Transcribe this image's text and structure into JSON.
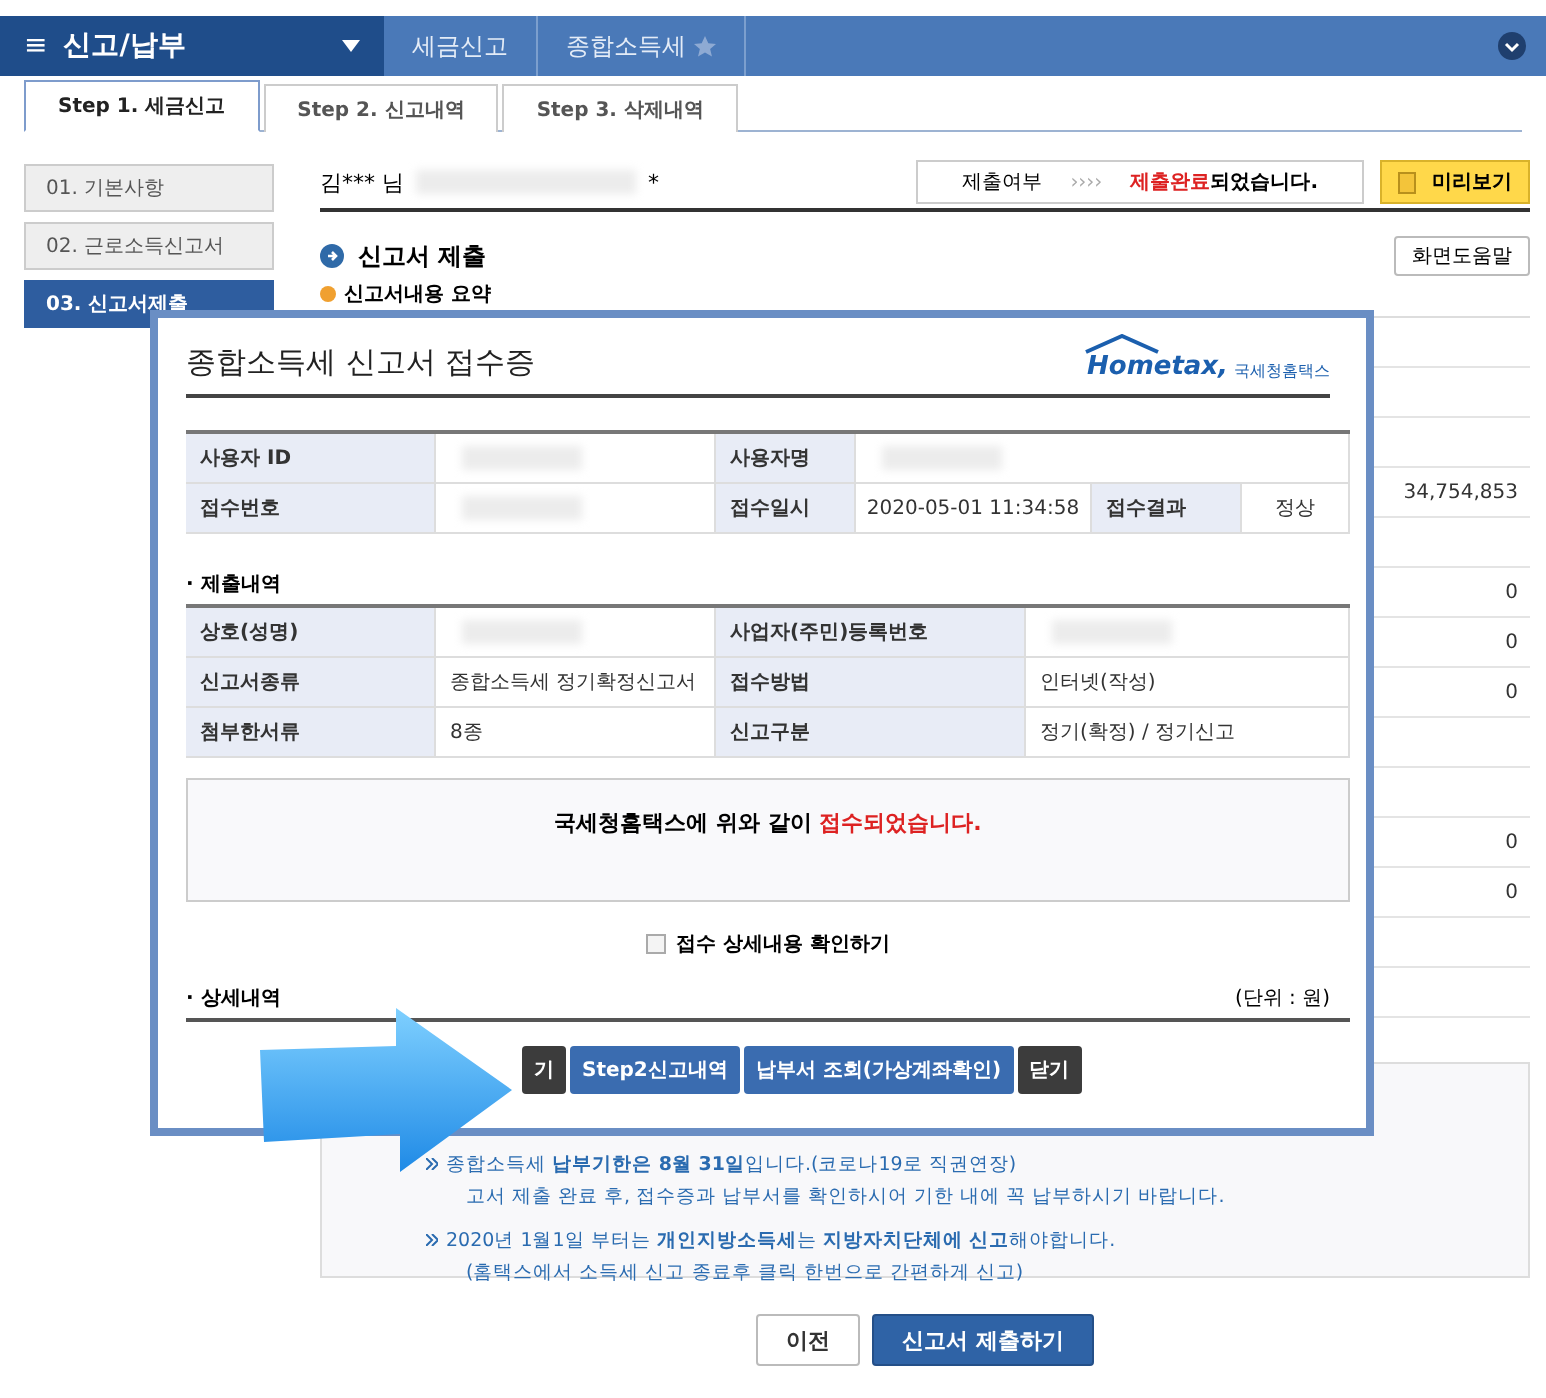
{
  "nav": {
    "menu_icon": "≡",
    "title": "신고/납부",
    "breadcrumbs": [
      {
        "label": "세금신고",
        "star": false
      },
      {
        "label": "종합소득세",
        "star": true
      }
    ]
  },
  "steps": [
    {
      "label": "Step 1. 세금신고",
      "selected": true
    },
    {
      "label": "Step 2. 신고내역",
      "selected": false
    },
    {
      "label": "Step 3. 삭제내역",
      "selected": false
    }
  ],
  "sidebar": [
    {
      "label": "01. 기본사항",
      "selected": false
    },
    {
      "label": "02. 근로소득신고서",
      "selected": false
    },
    {
      "label": "03. 신고서제출",
      "selected": true
    }
  ],
  "user_line": {
    "name": "김*** 님",
    "tail": "*"
  },
  "status": {
    "label": "제출여부",
    "arrows": "››››",
    "highlight": "제출완료",
    "rest": "되었습니다."
  },
  "preview_button": "미리보기",
  "section_title": "신고서 제출",
  "help_button": "화면도움말",
  "subsection": "신고서내용 요약",
  "summary_rows": [
    {
      "kind": "blank"
    },
    {
      "kind": "blank"
    },
    {
      "kind": "blank"
    },
    {
      "kind": "amount",
      "value": "34,754,853"
    },
    {
      "kind": "blank"
    },
    {
      "kind": "amount",
      "value": "0"
    },
    {
      "kind": "amount",
      "value": "0"
    },
    {
      "kind": "amount",
      "value": "0"
    },
    {
      "kind": "blank"
    },
    {
      "kind": "blank"
    },
    {
      "kind": "amount",
      "value": "0"
    },
    {
      "kind": "amount",
      "value": "0"
    },
    {
      "kind": "blank"
    },
    {
      "kind": "blank"
    }
  ],
  "notes": [
    {
      "kind": "bullet",
      "text": "종합소득세 **납부기한은 8월 31일**입니다.(코로나19로 직권연장)"
    },
    {
      "kind": "continuation",
      "text": "고서 제출 완료 후, 접수증과 납부서를 확인하시어 기한 내에 꼭 납부하시기 바랍니다."
    },
    {
      "kind": "bullet",
      "text": "2020년 1월1일 부터는 **개인지방소득세**는 **지방자치단체에 신고**해야합니다."
    },
    {
      "kind": "continuation",
      "text": "(홈택스에서 소득세 신고 종료후 클릭 한번으로 간편하게 신고)"
    }
  ],
  "bottom_buttons": [
    {
      "label": "이전",
      "kind": "secondary"
    },
    {
      "label": "신고서 제출하기",
      "kind": "primary"
    }
  ],
  "dialog": {
    "title": "종합소득세 신고서 접수증",
    "logo": {
      "main": "Hometax,",
      "sub": "국세청홈택스"
    },
    "info_rows": [
      [
        {
          "kind": "label",
          "text": "사용자 ID"
        },
        {
          "kind": "masked"
        },
        {
          "kind": "label",
          "text": "사용자명"
        },
        {
          "kind": "masked",
          "wide": true
        }
      ],
      [
        {
          "kind": "label",
          "text": "접수번호"
        },
        {
          "kind": "masked"
        },
        {
          "kind": "label",
          "text": "접수일시"
        },
        {
          "kind": "value",
          "text": "2020-05-01 11:34:58"
        },
        {
          "kind": "label",
          "text": "접수결과"
        },
        {
          "kind": "value",
          "text": "정상"
        }
      ]
    ],
    "submission_title": "· 제출내역",
    "submission_rows": [
      [
        {
          "kind": "label",
          "text": "상호(성명)"
        },
        {
          "kind": "masked"
        },
        {
          "kind": "label",
          "text": "사업자(주민)등록번호"
        },
        {
          "kind": "masked"
        }
      ],
      [
        {
          "kind": "label",
          "text": "신고서종류"
        },
        {
          "kind": "value",
          "text": "종합소득세 정기확정신고서"
        },
        {
          "kind": "label",
          "text": "접수방법"
        },
        {
          "kind": "value",
          "text": "인터넷(작성)"
        }
      ],
      [
        {
          "kind": "label",
          "text": "첨부한서류"
        },
        {
          "kind": "value",
          "text": "8종"
        },
        {
          "kind": "label",
          "text": "신고구분"
        },
        {
          "kind": "value",
          "text": "정기(확정) / 정기신고"
        }
      ]
    ],
    "message": {
      "text": "국세청홈택스에 위와 같이 ",
      "highlight": "접수되었습니다."
    },
    "checkbox": {
      "label": "접수 상세내용 확인하기",
      "checked": false
    },
    "detail_title": "· 상세내역",
    "unit": "(단위 : 원)",
    "buttons": [
      {
        "label": "기",
        "kind": "dark"
      },
      {
        "label": "Step2신고내역",
        "kind": "blue"
      },
      {
        "label": "납부서 조회(가상계좌확인)",
        "kind": "blue"
      },
      {
        "label": "닫기",
        "kind": "dark"
      }
    ]
  }
}
